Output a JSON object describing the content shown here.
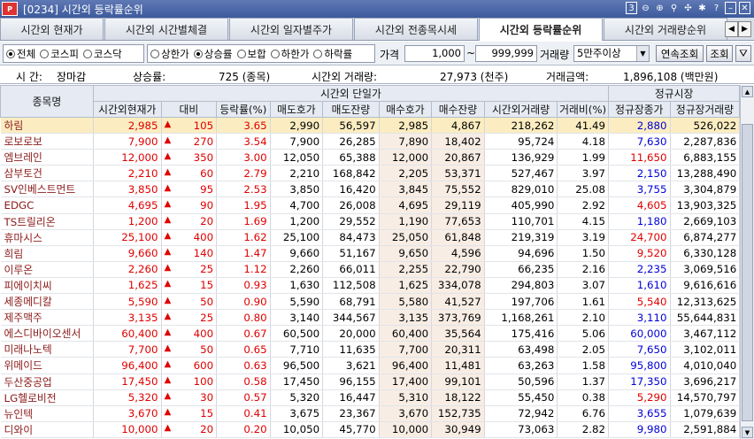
{
  "window": {
    "logo": "P",
    "title": "[0234] 시간외 등락률순위",
    "icons": [
      "3",
      "zoom-out",
      "zoom-in",
      "search",
      "pin",
      "star",
      "?",
      "min",
      "close"
    ]
  },
  "tabs": [
    {
      "label": "시간외 현재가"
    },
    {
      "label": "시간외 시간별체결"
    },
    {
      "label": "시간외 일자별주가"
    },
    {
      "label": "시간외 전종목시세"
    },
    {
      "label": "시간외 등락률순위",
      "active": true
    },
    {
      "label": "시간외 거래량순위"
    }
  ],
  "filters": {
    "market": [
      {
        "label": "전체",
        "on": true
      },
      {
        "label": "코스피"
      },
      {
        "label": "코스닥"
      }
    ],
    "rank": [
      {
        "label": "상한가"
      },
      {
        "label": "상승률",
        "on": true
      },
      {
        "label": "보합"
      },
      {
        "label": "하한가"
      },
      {
        "label": "하락률"
      }
    ],
    "price_label": "가격",
    "price_from": "1,000",
    "tilde": "~",
    "price_to": "999,999",
    "volume_label": "거래량",
    "volume_value": "5만주이상",
    "continuous_btn": "연속조회",
    "query_btn": "조회"
  },
  "summary": {
    "time_label": "시   간:",
    "time_value": "장마감",
    "ratio_label": "상승률:",
    "ratio_value": "725 (종목)",
    "vol_label": "시간외 거래량:",
    "vol_value": "27,973 (천주)",
    "amt_label": "거래금액:",
    "amt_value": "1,896,108 (백만원)"
  },
  "headers": {
    "name": "종목명",
    "group_after": "시간외 단일가",
    "group_regular": "정규시장",
    "cols": [
      "시간외현재가",
      "대비",
      "등락률(%)",
      "매도호가",
      "매도잔량",
      "매수호가",
      "매수잔량",
      "시간외거래량",
      "거래비(%)",
      "정규장종가",
      "정규장거래량"
    ]
  },
  "up_arrow": "▲",
  "rows": [
    [
      "하림",
      "2,985",
      "105",
      "3.65",
      "2,990",
      "56,597",
      "2,985",
      "4,867",
      "218,262",
      "41.49",
      "2,880",
      "526,022",
      "b"
    ],
    [
      "로보로보",
      "7,900",
      "270",
      "3.54",
      "7,900",
      "26,285",
      "7,890",
      "18,402",
      "95,724",
      "4.18",
      "7,630",
      "2,287,836",
      "b"
    ],
    [
      "엠브레인",
      "12,000",
      "350",
      "3.00",
      "12,050",
      "65,388",
      "12,000",
      "20,867",
      "136,929",
      "1.99",
      "11,650",
      "6,883,155",
      "r"
    ],
    [
      "삼부토건",
      "2,210",
      "60",
      "2.79",
      "2,210",
      "168,842",
      "2,205",
      "53,371",
      "527,467",
      "3.97",
      "2,150",
      "13,288,490",
      "b"
    ],
    [
      "SV인베스트먼트",
      "3,850",
      "95",
      "2.53",
      "3,850",
      "16,420",
      "3,845",
      "75,552",
      "829,010",
      "25.08",
      "3,755",
      "3,304,879",
      "b"
    ],
    [
      "EDGC",
      "4,695",
      "90",
      "1.95",
      "4,700",
      "26,008",
      "4,695",
      "29,119",
      "405,990",
      "2.92",
      "4,605",
      "13,903,325",
      "r"
    ],
    [
      "TS트릴리온",
      "1,200",
      "20",
      "1.69",
      "1,200",
      "29,552",
      "1,190",
      "77,653",
      "110,701",
      "4.15",
      "1,180",
      "2,669,103",
      "b"
    ],
    [
      "휴마시스",
      "25,100",
      "400",
      "1.62",
      "25,100",
      "84,473",
      "25,050",
      "61,848",
      "219,319",
      "3.19",
      "24,700",
      "6,874,277",
      "r"
    ],
    [
      "희림",
      "9,660",
      "140",
      "1.47",
      "9,660",
      "51,167",
      "9,650",
      "4,596",
      "94,696",
      "1.50",
      "9,520",
      "6,330,128",
      "r"
    ],
    [
      "이루온",
      "2,260",
      "25",
      "1.12",
      "2,260",
      "66,011",
      "2,255",
      "22,790",
      "66,235",
      "2.16",
      "2,235",
      "3,069,516",
      "b"
    ],
    [
      "피에이치씨",
      "1,625",
      "15",
      "0.93",
      "1,630",
      "112,508",
      "1,625",
      "334,078",
      "294,803",
      "3.07",
      "1,610",
      "9,616,616",
      "b"
    ],
    [
      "세종메디칼",
      "5,590",
      "50",
      "0.90",
      "5,590",
      "68,791",
      "5,580",
      "41,527",
      "197,706",
      "1.61",
      "5,540",
      "12,313,625",
      "r"
    ],
    [
      "제주맥주",
      "3,135",
      "25",
      "0.80",
      "3,140",
      "344,567",
      "3,135",
      "373,769",
      "1,168,261",
      "2.10",
      "3,110",
      "55,644,831",
      "b"
    ],
    [
      "에스디바이오센서",
      "60,400",
      "400",
      "0.67",
      "60,500",
      "20,000",
      "60,400",
      "35,564",
      "175,416",
      "5.06",
      "60,000",
      "3,467,112",
      "b"
    ],
    [
      "미래나노텍",
      "7,700",
      "50",
      "0.65",
      "7,710",
      "11,635",
      "7,700",
      "20,311",
      "63,498",
      "2.05",
      "7,650",
      "3,102,011",
      "b"
    ],
    [
      "위메이드",
      "96,400",
      "600",
      "0.63",
      "96,500",
      "3,621",
      "96,400",
      "11,481",
      "63,263",
      "1.58",
      "95,800",
      "4,010,040",
      "b"
    ],
    [
      "두산중공업",
      "17,450",
      "100",
      "0.58",
      "17,450",
      "96,155",
      "17,400",
      "99,101",
      "50,596",
      "1.37",
      "17,350",
      "3,696,217",
      "b"
    ],
    [
      "LG헬로비전",
      "5,320",
      "30",
      "0.57",
      "5,320",
      "16,447",
      "5,310",
      "18,122",
      "55,450",
      "0.38",
      "5,290",
      "14,570,797",
      "r"
    ],
    [
      "뉴인텍",
      "3,670",
      "15",
      "0.41",
      "3,675",
      "23,367",
      "3,670",
      "152,735",
      "72,942",
      "6.76",
      "3,655",
      "1,079,639",
      "b"
    ],
    [
      "디와이",
      "10,000",
      "20",
      "0.20",
      "10,050",
      "45,770",
      "10,000",
      "30,949",
      "73,063",
      "2.82",
      "9,980",
      "2,591,884",
      "b"
    ]
  ]
}
